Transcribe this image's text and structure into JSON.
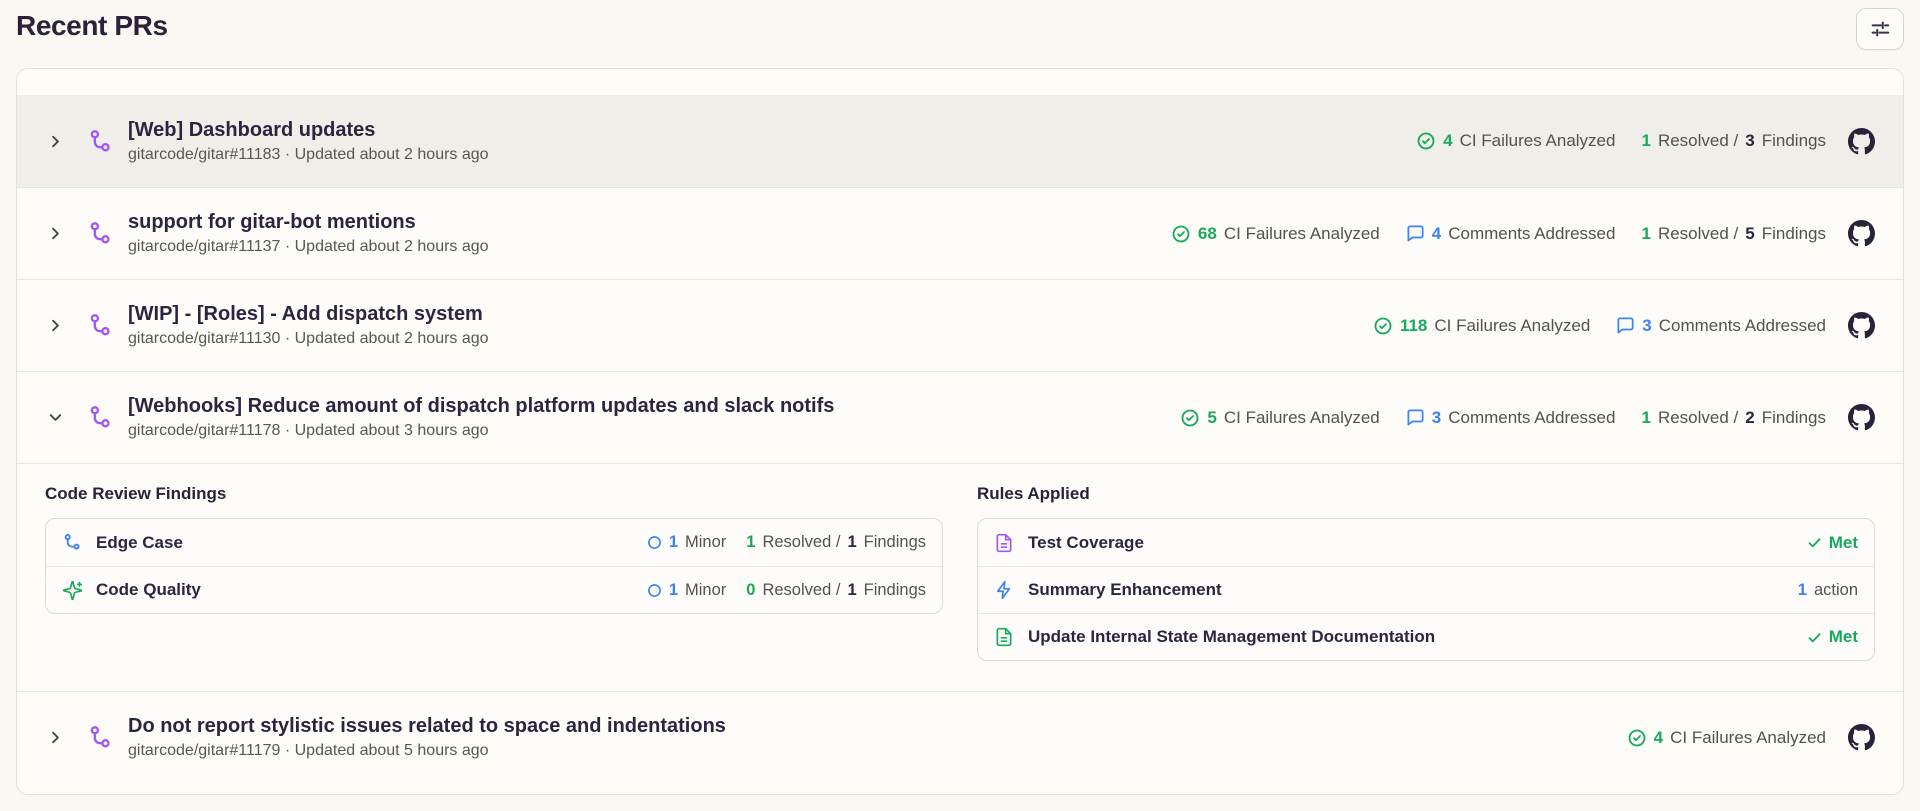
{
  "page": {
    "title": "Recent PRs"
  },
  "labels": {
    "ci": "CI Failures Analyzed",
    "comments": "Comments Addressed",
    "resolved_sep": "Resolved /",
    "findings": "Findings",
    "minor": "Minor"
  },
  "prs": [
    {
      "title": "[Web] Dashboard updates",
      "meta": "gitarcode/gitar#11183 · Updated about 2 hours ago",
      "ci_count": "4",
      "resolved_count": "1",
      "findings_count": "3"
    },
    {
      "title": "support for gitar-bot mentions",
      "meta": "gitarcode/gitar#11137 · Updated about 2 hours ago",
      "ci_count": "68",
      "comments_count": "4",
      "resolved_count": "1",
      "findings_count": "5"
    },
    {
      "title": "[WIP] - [Roles] - Add dispatch system",
      "meta": "gitarcode/gitar#11130 · Updated about 2 hours ago",
      "ci_count": "118",
      "comments_count": "3"
    },
    {
      "title": "[Webhooks] Reduce amount of dispatch platform updates and slack notifs",
      "meta": "gitarcode/gitar#11178 · Updated about 3 hours ago",
      "ci_count": "5",
      "comments_count": "3",
      "resolved_count": "1",
      "findings_count": "2"
    },
    {
      "title": "Do not report stylistic issues related to space and indentations",
      "meta": "gitarcode/gitar#11179 · Updated about 5 hours ago",
      "ci_count": "4"
    }
  ],
  "expanded": {
    "findings": {
      "title": "Code Review Findings",
      "rows": [
        {
          "label": "Edge Case",
          "minor_count": "1",
          "resolved_count": "1",
          "findings_count": "1"
        },
        {
          "label": "Code Quality",
          "minor_count": "1",
          "resolved_count": "0",
          "findings_count": "1"
        }
      ]
    },
    "rules": {
      "title": "Rules Applied",
      "rows": [
        {
          "label": "Test Coverage",
          "status": "Met"
        },
        {
          "label": "Summary Enhancement",
          "action_count": "1",
          "action_label": "action"
        },
        {
          "label": "Update Internal State Management Documentation",
          "status": "Met"
        }
      ]
    }
  },
  "colors": {
    "green": "#18a95c",
    "blue": "#3b82f6",
    "purple": "#a256f7",
    "dark": "#2e2440"
  }
}
